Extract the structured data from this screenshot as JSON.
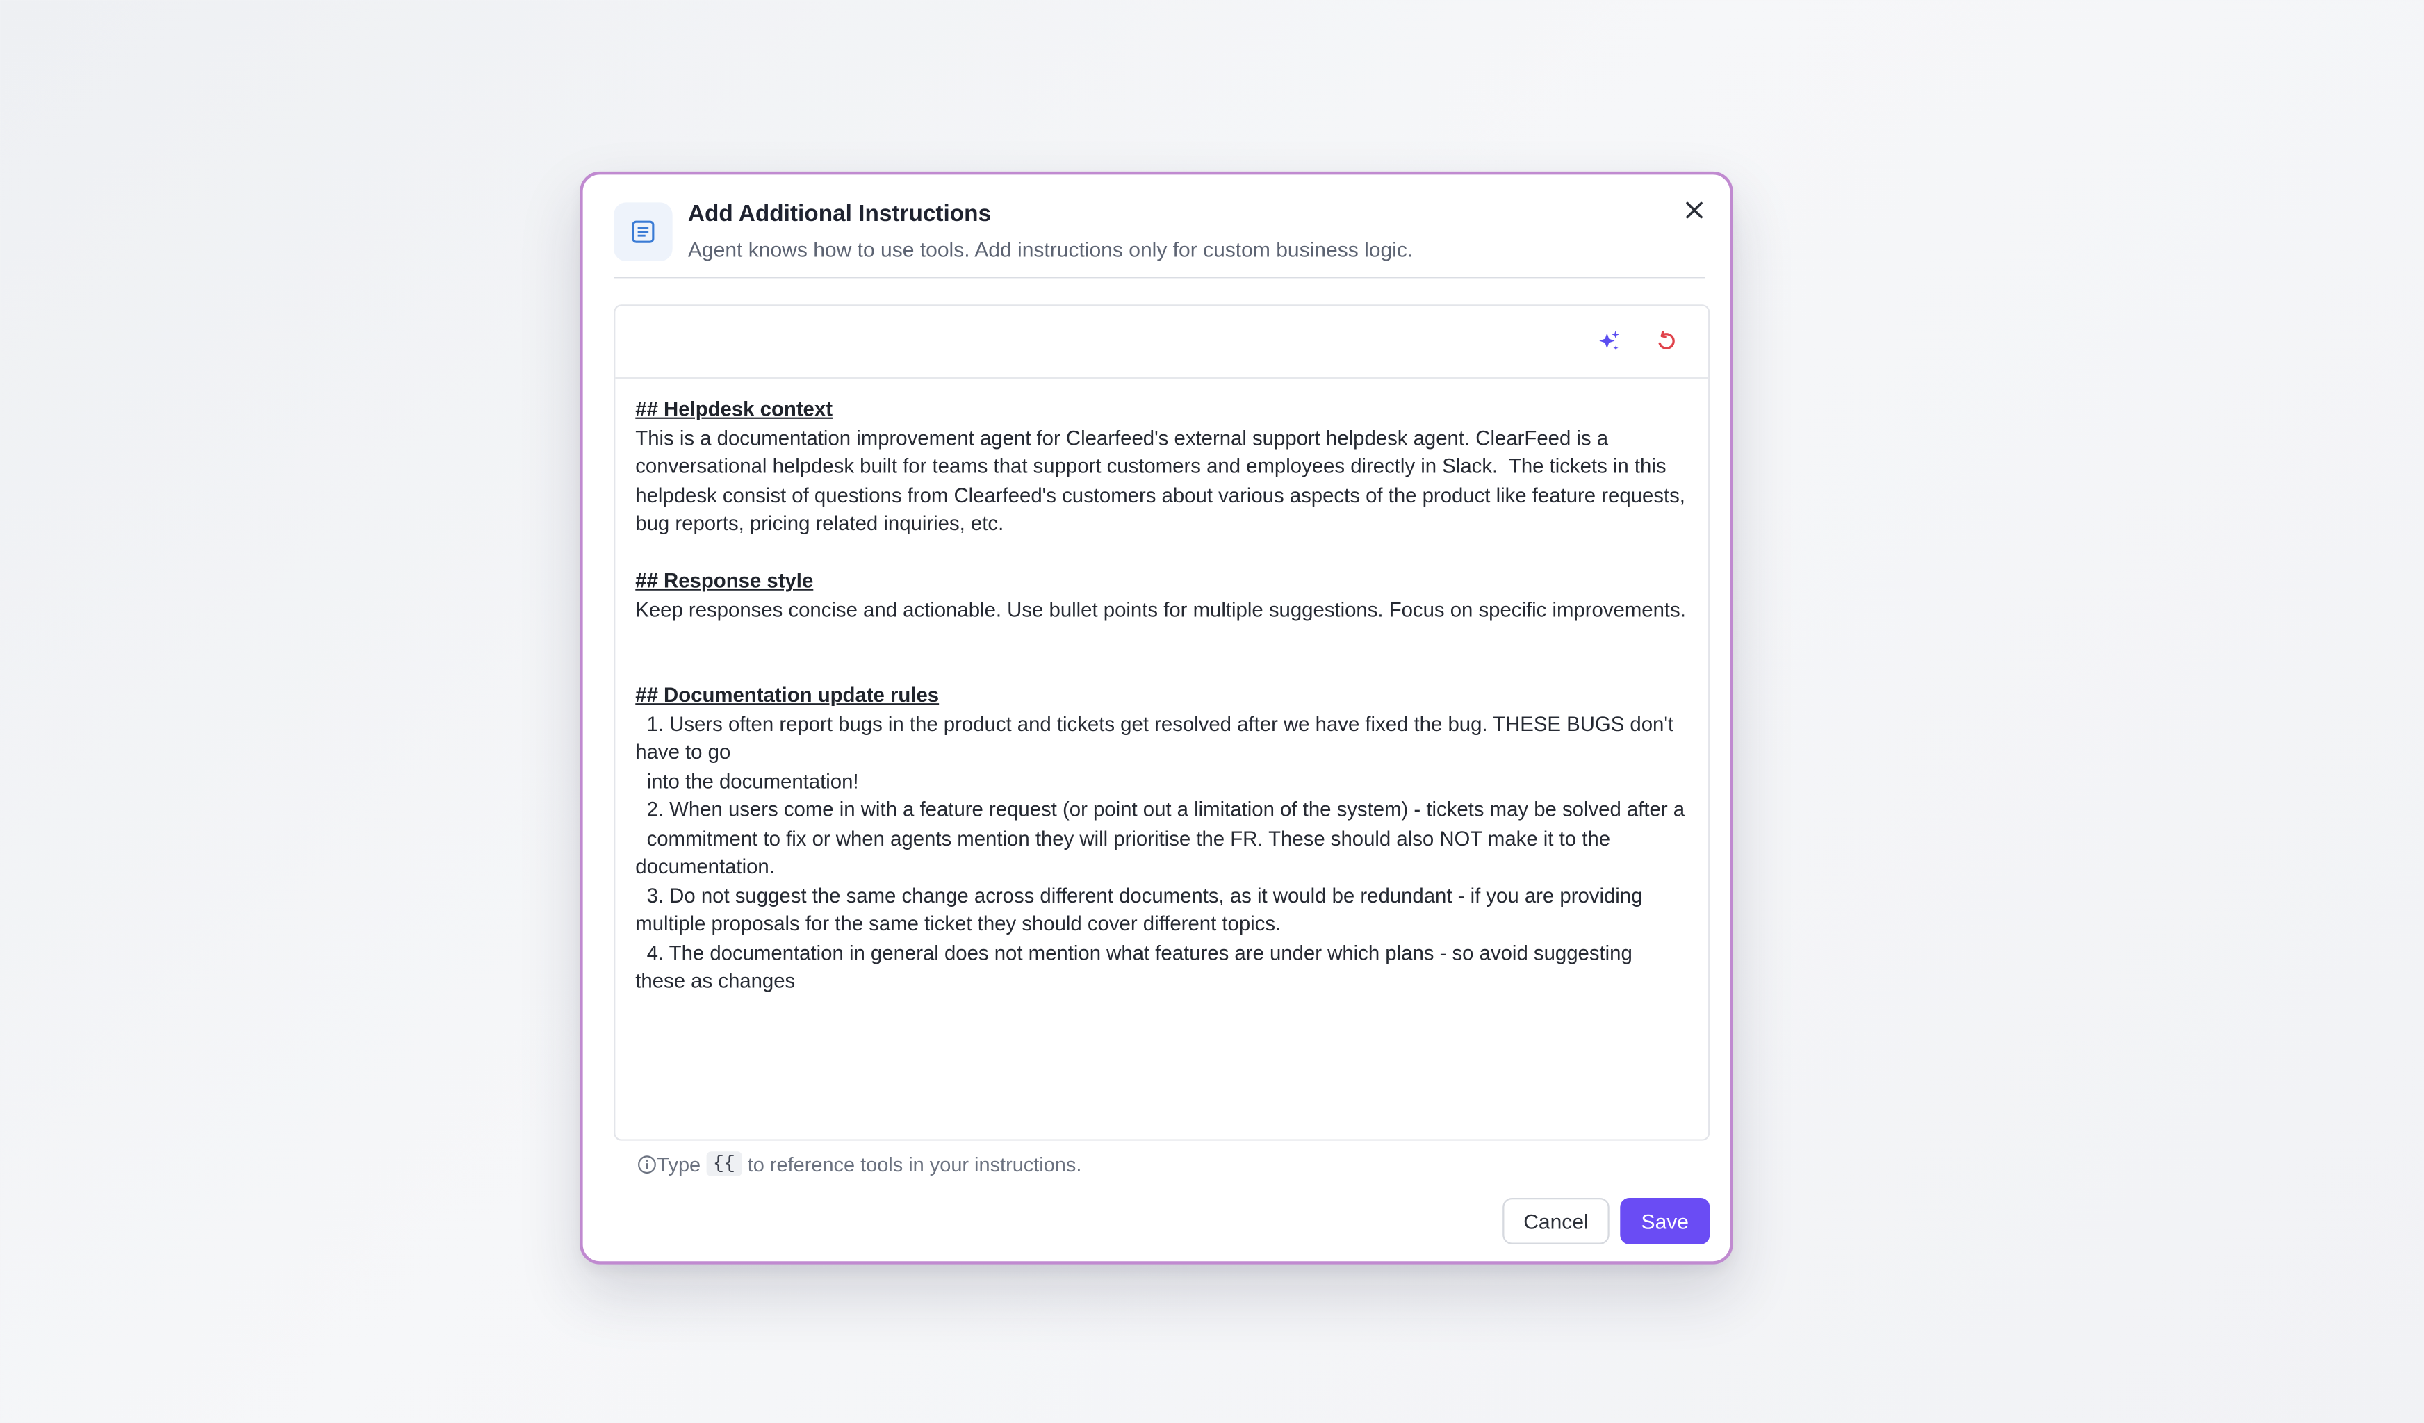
{
  "dialog": {
    "title": "Add Additional Instructions",
    "subtitle": "Agent knows how to use tools. Add instructions only for custom business logic.",
    "header_icon": "document-list-icon",
    "close_icon": "close-icon"
  },
  "editor": {
    "toolbar": {
      "ai_icon": "sparkles-icon",
      "reset_icon": "reset-icon"
    },
    "sections": [
      {
        "heading": "## Helpdesk context",
        "lines": [
          "This is a documentation improvement agent for Clearfeed's external support helpdesk agent. ClearFeed is a conversational helpdesk built for teams that support customers and employees directly in Slack.  The tickets in this helpdesk consist of questions from Clearfeed's customers about various aspects of the product like feature requests, bug reports, pricing related inquiries, etc."
        ]
      },
      {
        "heading": "## Response style",
        "lines": [
          "Keep responses concise and actionable. Use bullet points for multiple suggestions. Focus on specific improvements."
        ]
      },
      {
        "heading": "## Documentation update rules",
        "lines": [
          "  1. Users often report bugs in the product and tickets get resolved after we have fixed the bug. THESE BUGS don't have to go",
          "  into the documentation!",
          "  2. When users come in with a feature request (or point out a limitation of the system) - tickets may be solved after a",
          "  commitment to fix or when agents mention they will prioritise the FR. These should also NOT make it to the documentation.",
          "  3. Do not suggest the same change across different documents, as it would be redundant - if you are providing multiple proposals for the same ticket they should cover different topics.",
          "  4. The documentation in general does not mention what features are under which plans - so avoid suggesting these as changes"
        ]
      }
    ]
  },
  "hint": {
    "info_icon": "info-icon",
    "prefix": "Type",
    "token": "{{",
    "suffix": "to reference tools in your instructions."
  },
  "footer": {
    "cancel_label": "Cancel",
    "save_label": "Save"
  },
  "colors": {
    "accent": "#6a4cf4",
    "dialog_border": "#c08ad0",
    "reset_icon": "#e0434b",
    "header_icon": "#3a7bd5"
  }
}
